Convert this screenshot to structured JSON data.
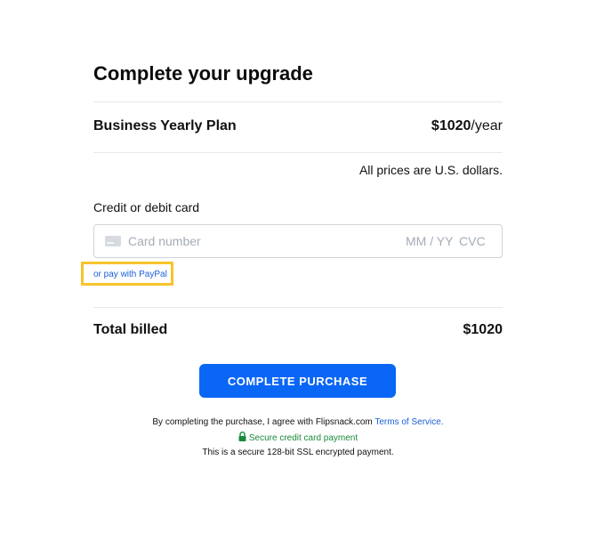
{
  "page": {
    "title": "Complete your upgrade"
  },
  "plan": {
    "name": "Business Yearly Plan",
    "price_amount": "$1020",
    "price_period": "/year",
    "currency_note": "All prices are U.S. dollars."
  },
  "payment": {
    "card_label": "Credit or debit card",
    "card_number_placeholder": "Card number",
    "expiry_placeholder": "MM / YY",
    "cvc_placeholder": "CVC",
    "card_icon": "credit-card-icon",
    "paypal_link": "or pay with PayPal"
  },
  "total": {
    "label": "Total billed",
    "amount": "$1020"
  },
  "actions": {
    "purchase_label": "COMPLETE PURCHASE"
  },
  "footer": {
    "terms_prefix": "By completing the purchase, I agree with Flipsnack.com",
    "terms_link": "Terms of Service.",
    "secure_label": "Secure credit card payment",
    "secure_icon": "lock-icon",
    "ssl_note": "This is a secure 128-bit SSL encrypted payment."
  },
  "colors": {
    "accent": "#0a66f5",
    "link": "#1a5fd8",
    "secure": "#1a8a3a",
    "highlight": "#f7c52b"
  }
}
